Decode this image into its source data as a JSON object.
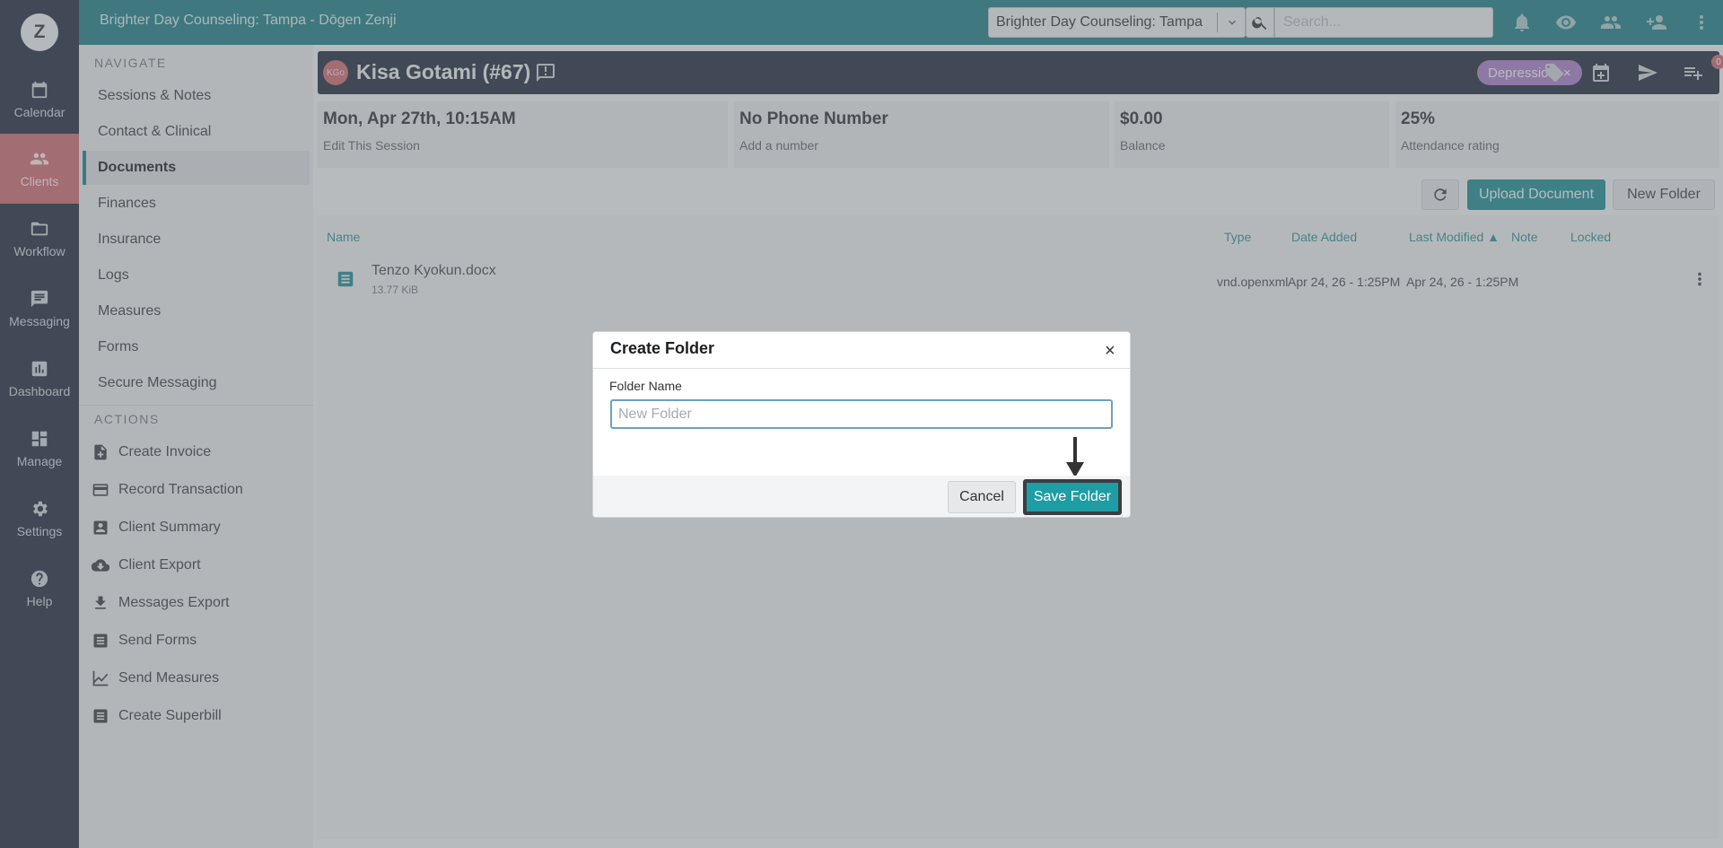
{
  "app": {
    "title": "Brighter Day Counseling: Tampa - Dōgen Zenji",
    "user_initial": "Z"
  },
  "rail": [
    {
      "label": "Calendar",
      "icon": "calendar-icon"
    },
    {
      "label": "Clients",
      "icon": "clients-icon",
      "active": true
    },
    {
      "label": "Workflow",
      "icon": "folder-icon"
    },
    {
      "label": "Messaging",
      "icon": "message-icon"
    },
    {
      "label": "Dashboard",
      "icon": "chart-icon"
    },
    {
      "label": "Manage",
      "icon": "grid-icon"
    },
    {
      "label": "Settings",
      "icon": "gear-icon"
    },
    {
      "label": "Help",
      "icon": "help-icon"
    }
  ],
  "topbar": {
    "location_select": "Brighter Day Counseling: Tampa",
    "search_placeholder": "Search..."
  },
  "sidebar": {
    "navigate_heading": "NAVIGATE",
    "nav_items": [
      "Sessions & Notes",
      "Contact & Clinical",
      "Documents",
      "Finances",
      "Insurance",
      "Logs",
      "Measures",
      "Forms",
      "Secure Messaging"
    ],
    "active_nav": "Documents",
    "actions_heading": "ACTIONS",
    "actions": [
      "Create Invoice",
      "Record Transaction",
      "Client Summary",
      "Client Export",
      "Messages Export",
      "Send Forms",
      "Send Measures",
      "Create Superbill"
    ]
  },
  "client": {
    "initials": "KGo",
    "name": "Kisa Gotami (#67)",
    "tag": "Depression",
    "tag_remove": "×",
    "badge_count": "0"
  },
  "cards": [
    {
      "big": "Mon, Apr 27th, 10:15AM",
      "small": "Edit This Session"
    },
    {
      "big": "No Phone Number",
      "small": "Add a number"
    },
    {
      "big": "$0.00",
      "small": "Balance"
    },
    {
      "big": "25%",
      "small": "Attendance rating"
    }
  ],
  "toolbar": {
    "upload_label": "Upload Document",
    "new_folder_label": "New Folder"
  },
  "table": {
    "headers": {
      "name": "Name",
      "type": "Type",
      "date_added": "Date Added",
      "last_modified": "Last Modified ▲",
      "note": "Note",
      "locked": "Locked"
    },
    "rows": [
      {
        "name": "Tenzo Kyokun.docx",
        "size": "13.77 KiB",
        "type": "vnd.openxml",
        "date_added": "Apr 24, 26 - 1:25PM",
        "last_modified": "Apr 24, 26 - 1:25PM"
      }
    ]
  },
  "modal": {
    "title": "Create Folder",
    "close": "×",
    "field_label": "Folder Name",
    "field_placeholder": "New Folder",
    "field_value": "",
    "cancel_label": "Cancel",
    "save_label": "Save Folder"
  }
}
